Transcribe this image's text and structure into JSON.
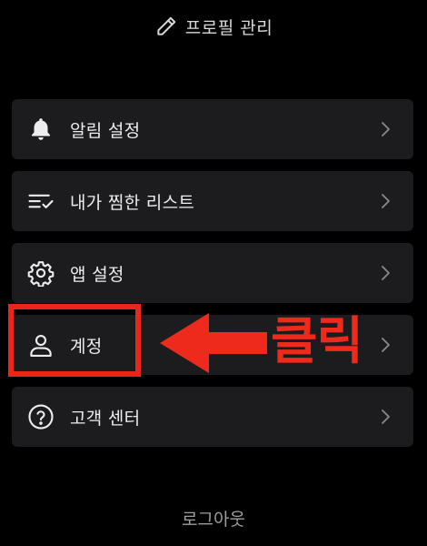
{
  "header": {
    "profile_manage_label": "프로필 관리",
    "icon": "pencil-icon"
  },
  "menu": {
    "items": [
      {
        "label": "알림 설정",
        "icon": "bell-icon"
      },
      {
        "label": "내가 찜한 리스트",
        "icon": "checklist-icon"
      },
      {
        "label": "앱 설정",
        "icon": "gear-icon"
      },
      {
        "label": "계정",
        "icon": "person-icon"
      },
      {
        "label": "고객 센터",
        "icon": "question-circle-icon"
      }
    ],
    "chevron_icon": "chevron-right-icon"
  },
  "annotation": {
    "text": "클릭",
    "color": "#ee2a1d",
    "target": "계정"
  },
  "footer": {
    "logout_label": "로그아웃"
  },
  "colors": {
    "background": "#000000",
    "card": "#1c1c1e",
    "text": "#ededed",
    "muted": "#9e9e9e",
    "accent": "#ee2a1d"
  }
}
